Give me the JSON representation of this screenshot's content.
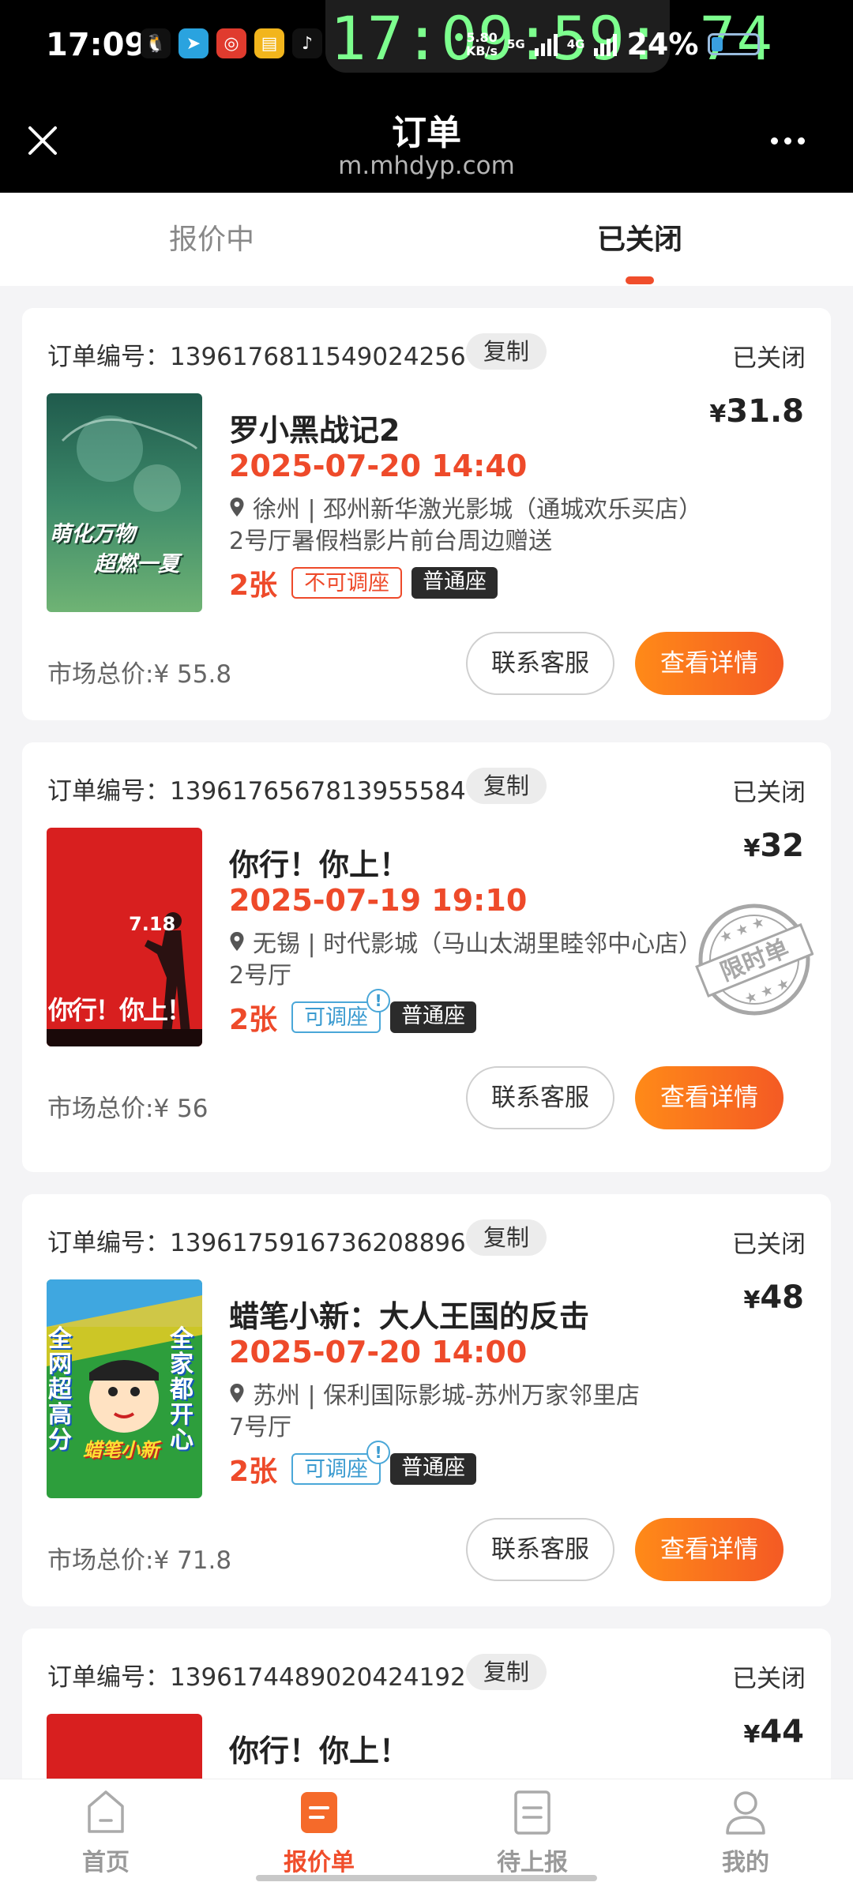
{
  "status_bar": {
    "time": "17:09",
    "overlay_clock": "17:09:59: 74",
    "net_speed": "5.80",
    "net_unit": "KB/s",
    "gen1": "5G",
    "gen2": "4G",
    "battery": "24%",
    "battery_level": 0.24,
    "apps": [
      "qq-icon",
      "telegram-icon",
      "app-icon",
      "wallet-icon",
      "tiktok-icon"
    ]
  },
  "titlebar": {
    "title": "订单",
    "url": "m.mhdyp.com"
  },
  "tabs": [
    {
      "label": "报价中",
      "active": false
    },
    {
      "label": "已关闭",
      "active": true
    }
  ],
  "labels": {
    "order_no_prefix": "订单编号：",
    "copy": "复制",
    "market_prefix": "市场总价:",
    "contact": "联系客服",
    "detail": "查看详情",
    "stamp": "限时单"
  },
  "orders": [
    {
      "order_no": "1396176811549024256",
      "status": "已关闭",
      "title": "罗小黑战记2",
      "price": "31.8",
      "currency": "¥",
      "time": "2025-07-20 14:40",
      "cinema": "徐州 | 邳州新华激光影城（通城欢乐买店）",
      "hall": "2号厅暑假档影片前台周边赠送",
      "qty": "2张",
      "tag_seat": "不可调座",
      "tag_type": "普通座",
      "market_total": "¥ 55.8",
      "poster_text": [
        "萌化万物",
        "超燃一夏"
      ]
    },
    {
      "order_no": "1396176567813955584",
      "status": "已关闭",
      "title": "你行！你上！",
      "price": "32",
      "currency": "¥",
      "time": "2025-07-19 19:10",
      "cinema": "无锡 | 时代影城（马山太湖里睦邻中心店）",
      "hall": "2号厅",
      "qty": "2张",
      "tag_seat": "可调座",
      "tag_type": "普通座",
      "market_total": "¥ 56",
      "poster_text": [
        "7.18",
        "你行！你上！"
      ]
    },
    {
      "order_no": "1396175916736208896",
      "status": "已关闭",
      "title": "蜡笔小新：大人王国的反击",
      "price": "48",
      "currency": "¥",
      "time": "2025-07-20 14:00",
      "cinema": "苏州 | 保利国际影城-苏州万家邻里店",
      "hall": "7号厅",
      "qty": "2张",
      "tag_seat": "可调座",
      "tag_type": "普通座",
      "market_total": "¥ 71.8",
      "poster_text": [
        "全网超高分",
        "全家都开心",
        "蜡笔小新"
      ]
    },
    {
      "order_no": "1396174489020424192",
      "status": "已关闭",
      "title": "你行！你上！",
      "price": "44",
      "currency": "¥"
    }
  ],
  "bottom_nav": [
    {
      "label": "首页",
      "icon": "home-icon",
      "active": false
    },
    {
      "label": "报价单",
      "icon": "quote-list-icon",
      "active": true
    },
    {
      "label": "待上报",
      "icon": "pending-report-icon",
      "active": false
    },
    {
      "label": "我的",
      "icon": "profile-icon",
      "active": false
    }
  ],
  "colors": {
    "accent": "#f04d2b",
    "price_red": "#ee4a2a",
    "button_gradient_start": "#ff8a18",
    "button_gradient_end": "#f45a24",
    "tag_blue": "#4aa7d8"
  }
}
